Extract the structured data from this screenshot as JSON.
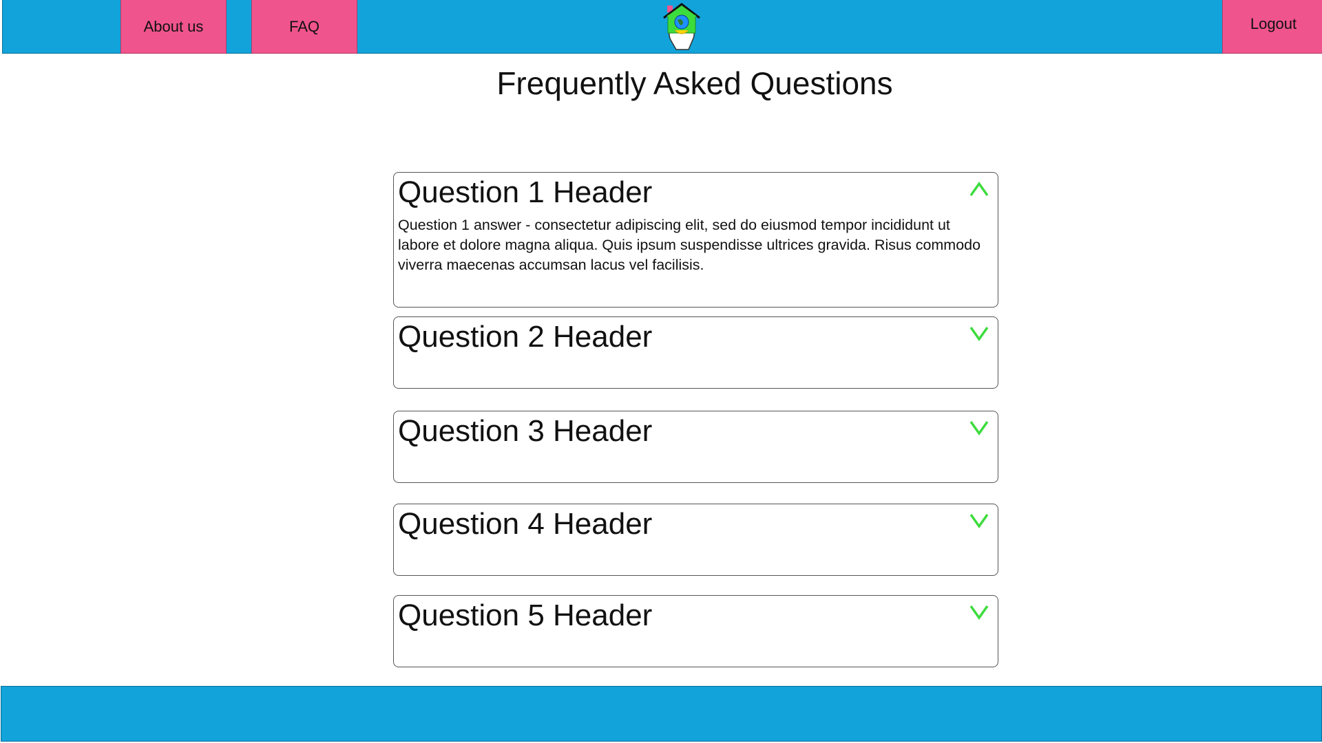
{
  "nav": {
    "about_label": "About us",
    "faq_label": "FAQ",
    "logout_label": "Logout",
    "logo_icon": "house-globe-hand-logo"
  },
  "page": {
    "title": "Frequently Asked Questions"
  },
  "faq": {
    "items": [
      {
        "header": "Question 1 Header",
        "answer": "Question 1 answer - consectetur adipiscing elit, sed do eiusmod tempor incididunt ut labore et dolore magna aliqua. Quis ipsum suspendisse ultrices gravida. Risus commodo viverra maecenas accumsan lacus vel facilisis.",
        "expanded": true,
        "icon": "chevron-up-icon"
      },
      {
        "header": "Question 2 Header",
        "expanded": false,
        "icon": "chevron-down-icon"
      },
      {
        "header": "Question 3 Header",
        "expanded": false,
        "icon": "chevron-down-icon"
      },
      {
        "header": "Question 4 Header",
        "expanded": false,
        "icon": "chevron-down-icon"
      },
      {
        "header": "Question 5 Header",
        "expanded": false,
        "icon": "chevron-down-icon"
      }
    ]
  },
  "colors": {
    "bar": "#12a3da",
    "accent": "#f0548d",
    "chevron": "#3ddc3d"
  }
}
